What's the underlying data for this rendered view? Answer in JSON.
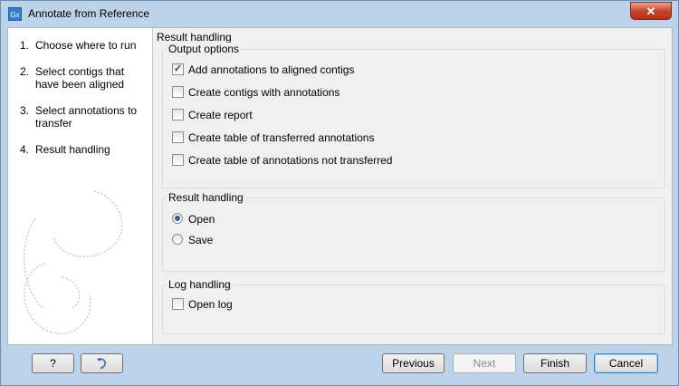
{
  "window": {
    "title": "Annotate from Reference",
    "app_icon_text": "Gx",
    "close_label": "✕"
  },
  "steps": [
    {
      "num": "1.",
      "label": "Choose where to run"
    },
    {
      "num": "2.",
      "label": "Select contigs that have been aligned"
    },
    {
      "num": "3.",
      "label": "Select annotations to transfer"
    },
    {
      "num": "4.",
      "label": "Result handling"
    }
  ],
  "main": {
    "section_title": "Result handling",
    "output_options": {
      "title": "Output options",
      "items": [
        {
          "label": "Add annotations to aligned contigs",
          "checked": true
        },
        {
          "label": "Create contigs with annotations",
          "checked": false
        },
        {
          "label": "Create report",
          "checked": false
        },
        {
          "label": "Create table of transferred annotations",
          "checked": false
        },
        {
          "label": "Create table of annotations not transferred",
          "checked": false
        }
      ]
    },
    "result_handling": {
      "title": "Result handling",
      "options": [
        {
          "label": "Open",
          "selected": true
        },
        {
          "label": "Save",
          "selected": false
        }
      ]
    },
    "log_handling": {
      "title": "Log handling",
      "open_log": {
        "label": "Open log",
        "checked": false
      }
    }
  },
  "footer": {
    "help_label": "?",
    "reset_icon": "undo-arrow-icon",
    "previous_label": "Previous",
    "next_label": "Next",
    "finish_label": "Finish",
    "cancel_label": "Cancel"
  }
}
